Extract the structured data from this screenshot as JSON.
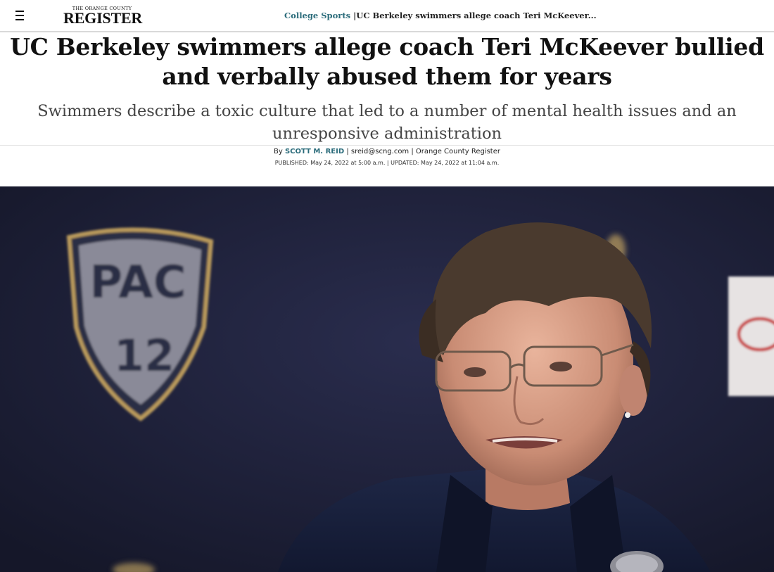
{
  "header": {
    "menu_icon": "hamburger-menu-icon",
    "logo_small": "THE ORANGE COUNTY",
    "logo_big": "REGISTER",
    "breadcrumb_section": "College Sports",
    "breadcrumb_separator": " |",
    "breadcrumb_title": "UC Berkeley swimmers allege coach Teri McKeever..."
  },
  "article": {
    "headline": "UC Berkeley swimmers allege coach Teri McKeever bullied and verbally abused them for years",
    "subheadline": "Swimmers describe a toxic culture that led to a number of mental health issues and an unresponsive administration",
    "byline_prefix": "By ",
    "author": "SCOTT M. REID",
    "byline_rest": " | sreid@scng.com | Orange County Register",
    "dates": "PUBLISHED: May 24, 2022 at 5:00 a.m. | UPDATED: May 24, 2022 at 11:04 a.m."
  },
  "photo": {
    "backdrop_logo_text": "PAC",
    "backdrop_logo_number": "12"
  }
}
